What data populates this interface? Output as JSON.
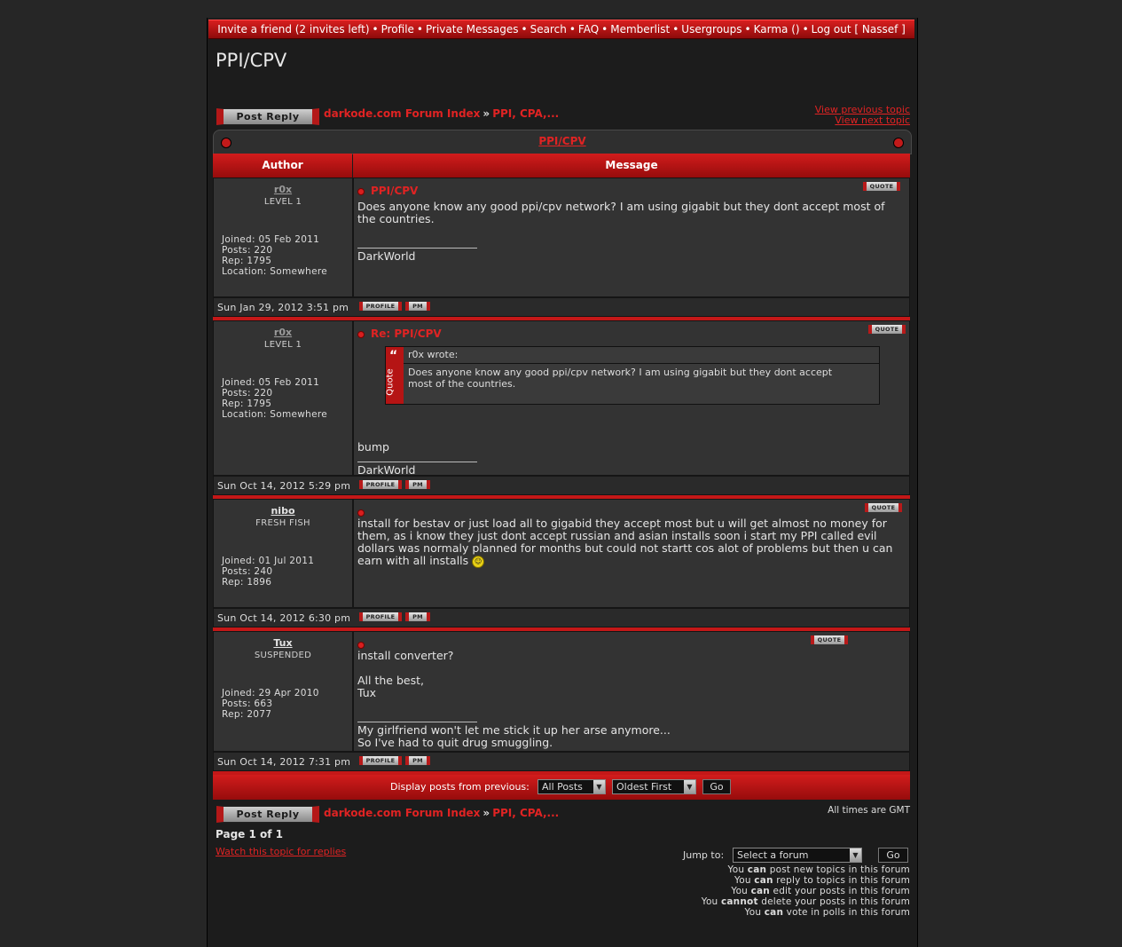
{
  "nav": {
    "items": [
      "Invite a friend (2 invites left)",
      "Profile",
      "Private Messages",
      "Search",
      "FAQ",
      "Memberlist",
      "Usergroups",
      "Karma ()",
      "Log out [ Nassef ]"
    ],
    "separator": "•"
  },
  "page": {
    "title": "PPI/CPV",
    "post_reply_label": "Post Reply",
    "breadcrumb": [
      "darkode.com Forum Index",
      "PPI, CPA,..."
    ],
    "breadcrumb_arrow": "»",
    "prev_topic": "View previous topic",
    "next_topic": "View next topic",
    "table_title": "PPI/CPV",
    "col_author": "Author",
    "col_message": "Message",
    "quote_label": "QUOTE",
    "profile_label": "PROFILE",
    "pm_label": "PM"
  },
  "posts": [
    {
      "author": "r0x",
      "rank": "LEVEL 1",
      "author_color": "#9a9a9a",
      "joined": "Joined: 05 Feb 2011",
      "posts": "Posts: 220",
      "rep": "Rep: 1795",
      "location": "Location: Somewhere",
      "subject": "PPI/CPV",
      "body": "Does anyone know any good ppi/cpv network? I am using gigabit but they dont accept most of the countries.",
      "signature": "DarkWorld",
      "date": "Sun Jan 29, 2012 3:51 pm"
    },
    {
      "author": "r0x",
      "rank": "LEVEL 1",
      "author_color": "#9a9a9a",
      "joined": "Joined: 05 Feb 2011",
      "posts": "Posts: 220",
      "rep": "Rep: 1795",
      "location": "Location: Somewhere",
      "subject": "Re: PPI/CPV",
      "quote_author": "r0x wrote:",
      "quote_text": "Does anyone know any good ppi/cpv network? I am using gigabit but they dont accept most of the countries.",
      "quote_side": "Quote",
      "body": "bump",
      "signature": "DarkWorld",
      "date": "Sun Oct 14, 2012 5:29 pm"
    },
    {
      "author": "nibo",
      "rank": "FRESH FISH",
      "author_color": "#e4e4e4",
      "joined": "Joined: 01 Jul 2011",
      "posts": "Posts: 240",
      "rep": "Rep: 1896",
      "subject": "",
      "body": "install for bestav or just load all to gigabid they accept most but u will get almost no money for them, as i know they just dont accept russian and asian installs soon i start my PPI called evil dollars was normaly planned for months but could not startt cos alot of problems but then u can earn with all installs",
      "date": "Sun Oct 14, 2012 6:30 pm"
    },
    {
      "author": "Tux",
      "rank": "SUSPENDED",
      "author_color": "#e4e4e4",
      "joined": "Joined: 29 Apr 2010",
      "posts": "Posts: 663",
      "rep": "Rep: 2077",
      "subject": "",
      "body_line1": "install converter?",
      "body_line2": "All the best,",
      "body_line3": "Tux",
      "sig_line1": "My girlfriend won't let me stick it up her arse anymore...",
      "sig_line2": "So I've had to quit drug smuggling.",
      "date": "Sun Oct 14, 2012 7:31 pm"
    }
  ],
  "footer": {
    "display_label": "Display posts from previous:",
    "display_value": "All Posts",
    "order_value": "Oldest First",
    "go_label": "Go",
    "timezone": "All times are GMT",
    "page_info": "Page 1 of 1",
    "watch_link": "Watch this topic for replies",
    "jump_label": "Jump to:",
    "jump_value": "Select a forum",
    "jump_go": "Go",
    "perm_can": "can",
    "perm_cannot": "cannot",
    "perm1": "post new topics in this forum",
    "perm2": "reply to topics in this forum",
    "perm3": "edit your posts in this forum",
    "perm4": "delete your posts in this forum",
    "perm5": "vote in polls in this forum",
    "you": "You"
  },
  "colors": {
    "accent": "#e02323",
    "bar": "#c41818",
    "bg": "#1c1c1c"
  }
}
